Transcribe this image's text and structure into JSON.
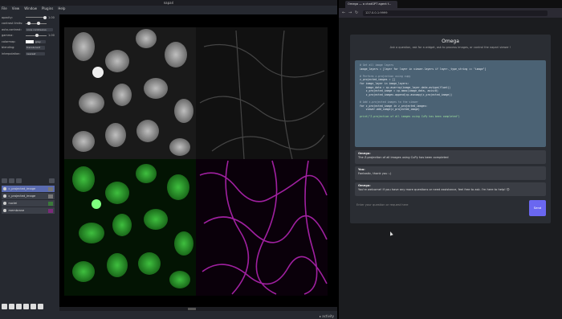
{
  "napari": {
    "title": "napari",
    "menu": [
      "File",
      "View",
      "Window",
      "Plugins",
      "Help"
    ],
    "controls": [
      {
        "label": "opacity:",
        "kind": "slider",
        "value": "1.00"
      },
      {
        "label": "contrast limits:",
        "kind": "slider"
      },
      {
        "label": "auto-contrast:",
        "kind": "buttons",
        "value": "once  continuous"
      },
      {
        "label": "gamma:",
        "kind": "slider",
        "value": "1.00"
      },
      {
        "label": "colormap:",
        "kind": "combo",
        "value": "gray"
      },
      {
        "label": "blending:",
        "kind": "combo",
        "value": "translucent"
      },
      {
        "label": "interpolation:",
        "kind": "combo",
        "value": "nearest"
      }
    ],
    "layers": [
      {
        "name": "c_projected_image",
        "selected": true
      },
      {
        "name": "c_projected_image",
        "selected": false
      },
      {
        "name": "nuclei",
        "selected": false
      },
      {
        "name": "membrane",
        "selected": false
      }
    ],
    "activity_label": "activity"
  },
  "browser": {
    "tab_title": "Omega — a chatGPT agent f...",
    "url": "127.0.0.1:9999"
  },
  "omega": {
    "title": "Omega",
    "subtitle": "Ask a question, ask for a widget, ask to process images, or control the napari viewer !",
    "code_lines": [
      {
        "t": "# Get all image layers",
        "c": "cm"
      },
      {
        "t": "image_layers = [layer for layer in viewer.layers if layer._type_string == \"image\"]",
        "c": ""
      },
      {
        "t": "",
        "c": ""
      },
      {
        "t": "# Perform z-projection using cupy",
        "c": "cm"
      },
      {
        "t": "z_projected_images = []",
        "c": ""
      },
      {
        "t": "for image_layer in image_layers:",
        "c": ""
      },
      {
        "t": "    image_data = cp.asarray(image_layer.data.astype(float))",
        "c": ""
      },
      {
        "t": "    z_projected_image = cp.amax(image_data, axis=0)",
        "c": ""
      },
      {
        "t": "    z_projected_images.append(cp.asnumpy(z_projected_image))",
        "c": ""
      },
      {
        "t": "",
        "c": ""
      },
      {
        "t": "# Add z-projected images to the viewer",
        "c": "cm"
      },
      {
        "t": "for z_projected_image in z_projected_images:",
        "c": ""
      },
      {
        "t": "    viewer.add_image(z_projected_image)",
        "c": ""
      },
      {
        "t": "",
        "c": ""
      },
      {
        "t": "print(\"Z-projection of all images using CuPy has been completed\")",
        "c": "str"
      }
    ],
    "messages": [
      {
        "who": "Omega:",
        "text": "The Z-projection of all images using CuPy has been completed"
      },
      {
        "who": "You:",
        "text": "Fantastic, thank you :-)"
      },
      {
        "who": "Omega:",
        "text": "You're welcome! If you have any more questions or need assistance, feel free to ask. I'm here to help! 😊"
      }
    ],
    "input_placeholder": "Enter your question or request here",
    "send_label": "Send"
  }
}
